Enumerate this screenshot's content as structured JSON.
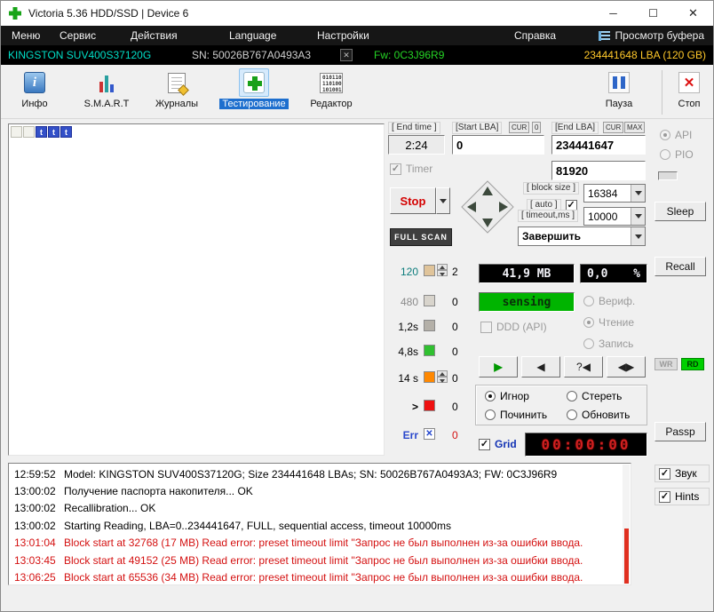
{
  "window": {
    "title": "Victoria 5.36 HDD/SSD | Device 6",
    "minimize": "─",
    "maximize": "☐",
    "close": "✕"
  },
  "menubar": {
    "items": [
      "Меню",
      "Сервис",
      "Действия",
      "Language",
      "Настройки",
      "Справка"
    ],
    "buffer_view": "Просмотр буфера"
  },
  "device_bar": {
    "model": "KINGSTON SUV400S37120G",
    "serial": "SN: 50026B767A0493A3",
    "firmware": "Fw: 0C3J96R9",
    "capacity": "234441648 LBA (120 GB)"
  },
  "toolbar": {
    "info": "Инфо",
    "smart": "S.M.A.R.T",
    "journals": "Журналы",
    "testing": "Тестирование",
    "editor": "Редактор",
    "pause": "Пауза",
    "stop": "Стоп"
  },
  "icons": {
    "stop_x": "✕",
    "serial_close": "✕",
    "play": "▶",
    "reverse": "◀",
    "question_seek": "?◀",
    "pair": "◀▶",
    "err_x": "✕"
  },
  "test_controls": {
    "end_time_label": "[ End time ]",
    "end_time": "2:24",
    "start_lba_label": "[Start LBA]",
    "cur": "CUR",
    "zero_btn": "0",
    "start_lba": "0",
    "end_lba_label": "[End LBA]",
    "max_btn": "MAX",
    "end_lba": "234441647",
    "timer_label": "Timer",
    "timer_value": "81920",
    "stop_button": "Stop",
    "full_scan": "FULL SCAN",
    "block_size_label": "[ block size ]",
    "auto_label": "[ auto ]",
    "block_size": "16384",
    "timeout_label": "[ timeout,ms ]",
    "timeout": "10000",
    "on_finish": "Завершить"
  },
  "speed_legend": {
    "rows": [
      {
        "label": "120",
        "count": "2",
        "color": "#e0c49a",
        "spinner": true
      },
      {
        "label": "480",
        "count": "0",
        "color": "#d8d4cc",
        "spinner": false
      },
      {
        "label": "1,2s",
        "count": "0",
        "color": "#b4b0a8",
        "spinner": false
      },
      {
        "label": "4,8s",
        "count": "0",
        "color": "#30c030",
        "spinner": false
      },
      {
        "label": "14 s",
        "count": "0",
        "color": "#ff8800",
        "spinner": true
      },
      {
        "label": ">",
        "count": "0",
        "color": "#ee1010",
        "spinner": false
      },
      {
        "label": "Err",
        "count": "0",
        "color": "#2244cc",
        "glyph": "✕"
      }
    ]
  },
  "displays": {
    "speed": "41,9 MB",
    "percent": "0,0",
    "percent_unit": "%",
    "status": "sensing",
    "grid_label": "Grid",
    "grid_timer": "00:00:00"
  },
  "mode_options": {
    "ddd_api": "DDD (API)",
    "verify": "Вериф.",
    "read": "Чтение",
    "write": "Запись",
    "ignore": "Игнор",
    "erase": "Стереть",
    "repair": "Починить",
    "refresh": "Обновить"
  },
  "side_panel": {
    "api": "API",
    "pio": "PIO",
    "sleep": "Sleep",
    "recall": "Recall",
    "wr": "WR",
    "rd": "RD",
    "passp": "Passp"
  },
  "block_map": {
    "blocks": [
      {
        "type": "free",
        "glyph": ""
      },
      {
        "type": "free",
        "glyph": ""
      },
      {
        "type": "timeout",
        "glyph": "t"
      },
      {
        "type": "timeout",
        "glyph": "t"
      },
      {
        "type": "timeout",
        "glyph": "t"
      }
    ]
  },
  "log": {
    "entries": [
      {
        "time": "12:59:52",
        "text": "Model: KINGSTON SUV400S37120G; Size 234441648 LBAs; SN: 50026B767A0493A3; FW: 0C3J96R9",
        "error": false
      },
      {
        "time": "13:00:02",
        "text": "Получение паспорта накопителя... OK",
        "error": false
      },
      {
        "time": "13:00:02",
        "text": "Recallibration... OK",
        "error": false
      },
      {
        "time": "13:00:02",
        "text": "Starting Reading, LBA=0..234441647, FULL, sequential access, timeout 10000ms",
        "error": false
      },
      {
        "time": "13:01:04",
        "text": "Block start at 32768 (17 MB) Read error: preset timeout limit \"Запрос не был выполнен из-за ошибки ввода.",
        "error": true
      },
      {
        "time": "13:03:45",
        "text": "Block start at 49152 (25 MB) Read error: preset timeout limit \"Запрос не был выполнен из-за ошибки ввода.",
        "error": true
      },
      {
        "time": "13:06:25",
        "text": "Block start at 65536 (34 MB) Read error: preset timeout limit \"Запрос не был выполнен из-за ошибки ввода.",
        "error": true
      }
    ]
  },
  "footer": {
    "sound": "Звук",
    "hints": "Hints"
  },
  "colors": {
    "model_cyan": "#00dfc8",
    "firmware_green": "#25d425",
    "capacity_yellow": "#ffc82a",
    "error_red": "#d41111",
    "status_lcd_green": "#00b400",
    "timer_lcd_red": "#d02020",
    "selected_tab_blue": "#1e6fce"
  }
}
